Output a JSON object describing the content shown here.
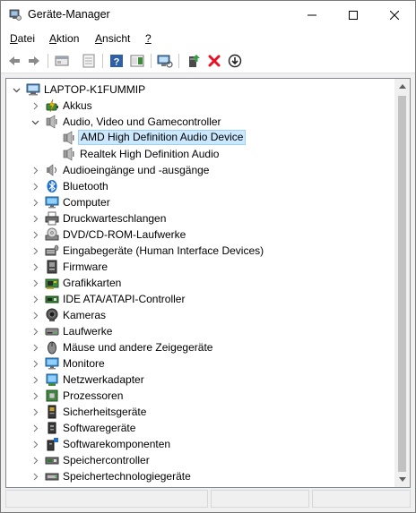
{
  "window": {
    "title": "Geräte-Manager",
    "icon": "device-manager-icon"
  },
  "menu": [
    {
      "label": "Datei"
    },
    {
      "label": "Aktion"
    },
    {
      "label": "Ansicht"
    },
    {
      "label": "?"
    }
  ],
  "toolbar": {
    "buttons": [
      "back-icon",
      "forward-icon",
      "properties-icon",
      "show-hide-icon",
      "help-icon",
      "action-pane-icon",
      "scan-hardware-icon",
      "update-driver-icon",
      "uninstall-icon",
      "download-icon"
    ]
  },
  "tree": {
    "root": "LAPTOP-K1FUMMIP",
    "categories": [
      {
        "label": "Akkus",
        "icon": "battery-icon",
        "expanded": false
      },
      {
        "label": "Audio, Video und Gamecontroller",
        "icon": "speaker-icon",
        "expanded": true,
        "children": [
          {
            "label": "AMD High Definition Audio Device",
            "icon": "speaker-icon",
            "selected": true
          },
          {
            "label": "Realtek High Definition Audio",
            "icon": "speaker-icon",
            "selected": false
          }
        ]
      },
      {
        "label": "Audioeingänge und -ausgänge",
        "icon": "audio-io-icon",
        "expanded": false
      },
      {
        "label": "Bluetooth",
        "icon": "bluetooth-icon",
        "expanded": false
      },
      {
        "label": "Computer",
        "icon": "computer-icon",
        "expanded": false
      },
      {
        "label": "Druckwarteschlangen",
        "icon": "printer-icon",
        "expanded": false
      },
      {
        "label": "DVD/CD-ROM-Laufwerke",
        "icon": "disc-drive-icon",
        "expanded": false
      },
      {
        "label": "Eingabegeräte (Human Interface Devices)",
        "icon": "hid-icon",
        "expanded": false
      },
      {
        "label": "Firmware",
        "icon": "firmware-icon",
        "expanded": false
      },
      {
        "label": "Grafikkarten",
        "icon": "display-adapter-icon",
        "expanded": false
      },
      {
        "label": "IDE ATA/ATAPI-Controller",
        "icon": "ide-controller-icon",
        "expanded": false
      },
      {
        "label": "Kameras",
        "icon": "camera-icon",
        "expanded": false
      },
      {
        "label": "Laufwerke",
        "icon": "disk-drive-icon",
        "expanded": false
      },
      {
        "label": "Mäuse und andere Zeigegeräte",
        "icon": "mouse-icon",
        "expanded": false
      },
      {
        "label": "Monitore",
        "icon": "monitor-icon",
        "expanded": false
      },
      {
        "label": "Netzwerkadapter",
        "icon": "network-adapter-icon",
        "expanded": false
      },
      {
        "label": "Prozessoren",
        "icon": "processor-icon",
        "expanded": false
      },
      {
        "label": "Sicherheitsgeräte",
        "icon": "security-device-icon",
        "expanded": false
      },
      {
        "label": "Softwaregeräte",
        "icon": "software-device-icon",
        "expanded": false
      },
      {
        "label": "Softwarekomponenten",
        "icon": "software-component-icon",
        "expanded": false
      },
      {
        "label": "Speichercontroller",
        "icon": "storage-controller-icon",
        "expanded": false
      },
      {
        "label": "Speichertechnologiegeräte",
        "icon": "storage-tech-icon",
        "expanded": false
      }
    ]
  },
  "colors": {
    "selection_bg": "#cce8ff",
    "selection_border": "#99d1ff",
    "uninstall_red": "#e81123"
  }
}
